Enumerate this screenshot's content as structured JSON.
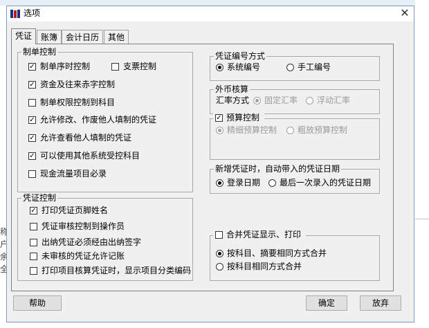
{
  "window": {
    "title": "选项",
    "close_symbol": "✕"
  },
  "tabs": [
    {
      "label": "凭证",
      "active": true
    },
    {
      "label": "账簿",
      "active": false
    },
    {
      "label": "会计日历",
      "active": false
    },
    {
      "label": "其他",
      "active": false
    }
  ],
  "voucher_making_control": {
    "legend": "制单控制",
    "items": [
      {
        "label": "制单序时控制",
        "checked": true
      },
      {
        "label": "支票控制",
        "checked": false
      },
      {
        "label": "资金及往来赤字控制",
        "checked": true
      },
      {
        "label": "制单权限控制到科目",
        "checked": false
      },
      {
        "label": "允许修改、作废他人填制的凭证",
        "checked": true
      },
      {
        "label": "允许查看他人填制的凭证",
        "checked": true
      },
      {
        "label": "可以使用其他系统受控科目",
        "checked": true
      },
      {
        "label": "现金流量项目必录",
        "checked": false
      }
    ]
  },
  "voucher_control": {
    "legend": "凭证控制",
    "items": [
      {
        "label": "打印凭证页脚姓名",
        "checked": true
      },
      {
        "label": "凭证审核控制到操作员",
        "checked": false
      },
      {
        "label": "出纳凭证必须经由出纳签字",
        "checked": false
      },
      {
        "label": "未审核的凭证允许记账",
        "checked": false
      },
      {
        "label": "打印项目核算凭证时，显示项目分类编码",
        "checked": false
      }
    ]
  },
  "numbering": {
    "legend": "凭证编号方式",
    "options": [
      {
        "label": "系统编号",
        "selected": true
      },
      {
        "label": "手工编号",
        "selected": false
      }
    ]
  },
  "foreign_currency": {
    "legend": "外币核算",
    "rate_label": "汇率方式",
    "options": [
      {
        "label": "固定汇率",
        "selected": true
      },
      {
        "label": "浮动汇率",
        "selected": false
      }
    ]
  },
  "budget": {
    "label": "预算控制",
    "checked": true,
    "options": [
      {
        "label": "精细预算控制",
        "selected": true
      },
      {
        "label": "粗放预算控制",
        "selected": false
      }
    ]
  },
  "new_voucher_date": {
    "legend": "新增凭证时，自动带入的凭证日期",
    "options": [
      {
        "label": "登录日期",
        "selected": true
      },
      {
        "label": "最后一次录入的凭证日期",
        "selected": false
      }
    ]
  },
  "merge_display": {
    "label": "合并凭证显示、打印",
    "checked": false,
    "options": [
      {
        "label": "按科目、摘要相同方式合并",
        "selected": true
      },
      {
        "label": "按科目相同方式合并",
        "selected": false
      }
    ]
  },
  "buttons": {
    "help": "帮助",
    "ok": "确定",
    "cancel": "放弃"
  },
  "background_fragments": [
    "称",
    "户",
    "余",
    "全"
  ]
}
